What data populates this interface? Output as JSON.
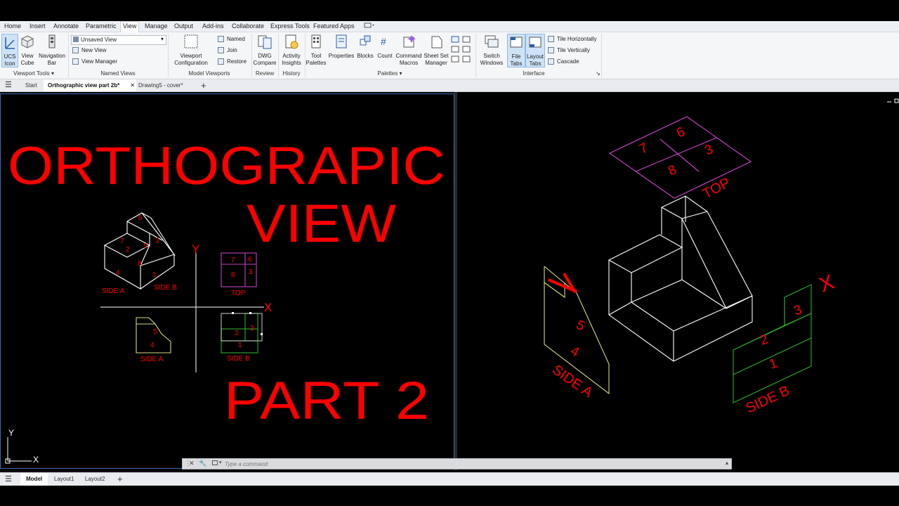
{
  "menu": {
    "tabs": [
      "Home",
      "Insert",
      "Annotate",
      "Parametric",
      "View",
      "Manage",
      "Output",
      "Add-ins",
      "Collaborate",
      "Express Tools",
      "Featured Apps"
    ],
    "active": "View"
  },
  "ribbon": {
    "ucs_icon": "UCS\nIcon",
    "view_cube": "View\nCube",
    "navigation_bar": "Navigation\nBar",
    "viewport_tools_label": "Viewport Tools",
    "named_views": {
      "dropdown_value": "Unsaved View",
      "new_view": "New View",
      "view_manager": "View Manager",
      "label": "Named Views"
    },
    "viewport_configuration": "Viewport\nConfiguration",
    "named": "Named",
    "join": "Join",
    "restore": "Restore",
    "model_viewports_label": "Model Viewports",
    "dwg_compare": "DWG\nCompare",
    "review_label": "Review",
    "activity_insights": "Activity\nInsights",
    "history_label": "History",
    "tool_palettes": "Tool\nPalettes",
    "properties": "Properties",
    "blocks": "Blocks",
    "count": "Count",
    "command_macros": "Command\nMacros",
    "sheet_set_manager": "Sheet Set\nManager",
    "palettes_label": "Palettes",
    "switch_windows": "Switch\nWindows",
    "file_tabs": "File\nTabs",
    "layout_tabs": "Layout\nTabs",
    "tile_horizontally": "Tile Horizontally",
    "tile_vertically": "Tile Vertically",
    "cascade": "Cascade",
    "interface_label": "Interface"
  },
  "file_tabs": {
    "start": "Start",
    "active": "Orthographic view part 2b*",
    "other": "Drawing5 - cover*"
  },
  "drawing_left": {
    "title_line1": "ORTHOGRAPIC",
    "title_line2": "VIEW",
    "subtitle": "PART 2",
    "axis_y": "Y",
    "axis_x": "X",
    "iso_faces": [
      "6",
      "7",
      "2",
      "5",
      "3",
      "8",
      "4",
      "1"
    ],
    "iso_side_a": "SIDE A",
    "iso_side_b": "SIDE B",
    "top_view_faces": [
      "7",
      "6",
      "8",
      "3"
    ],
    "top_label": "TOP",
    "side_a_faces": [
      "5",
      "4"
    ],
    "side_a_label": "SIDE A",
    "side_b_faces": [
      "3",
      "2",
      "1"
    ],
    "side_b_label": "SIDE B",
    "ucs_y": "Y",
    "ucs_x": "X"
  },
  "drawing_right": {
    "top_faces": [
      "7",
      "6",
      "3",
      "8"
    ],
    "top_label": "TOP",
    "side_a_faces": [
      "5",
      "4"
    ],
    "side_a_label": "SIDE A",
    "side_b_faces": [
      "3",
      "2",
      "1"
    ],
    "side_b_label": "SIDE B",
    "x_mark": "X"
  },
  "command": {
    "placeholder": "Type a command"
  },
  "layout_tabs": {
    "model": "Model",
    "layout1": "Layout1",
    "layout2": "Layout2"
  },
  "colors": {
    "red_text": "#ff0000",
    "top_view": "#c040c0",
    "side_a": "#d8d880",
    "side_b": "#2faa2f",
    "accent": "#3a6fb6"
  }
}
